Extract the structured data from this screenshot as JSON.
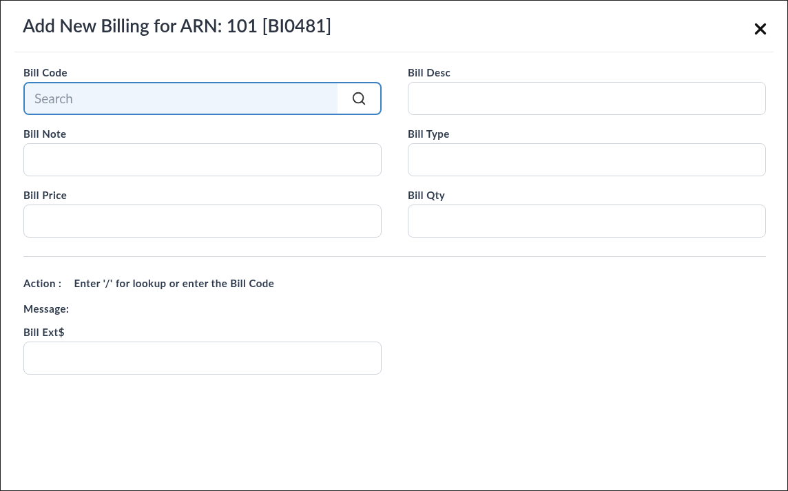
{
  "dialog": {
    "title": "Add New Billing for ARN: 101 [BI0481]"
  },
  "fields": [
    {
      "label": "Bill Code",
      "kind": "search",
      "placeholder": "Search",
      "focused": true
    },
    {
      "label": "Bill Desc",
      "kind": "text",
      "focused": false
    },
    {
      "label": "Bill Note",
      "kind": "text",
      "focused": false
    },
    {
      "label": "Bill Type",
      "kind": "text",
      "focused": false
    },
    {
      "label": "Bill Price",
      "kind": "text",
      "focused": false
    },
    {
      "label": "Bill Qty",
      "kind": "text",
      "focused": false
    }
  ],
  "action": {
    "label": "Action :",
    "text": "Enter '/' for lookup or enter the Bill Code"
  },
  "message": {
    "label": "Message:"
  },
  "extra_field": {
    "label": "Bill Ext$",
    "kind": "text",
    "focused": false
  }
}
